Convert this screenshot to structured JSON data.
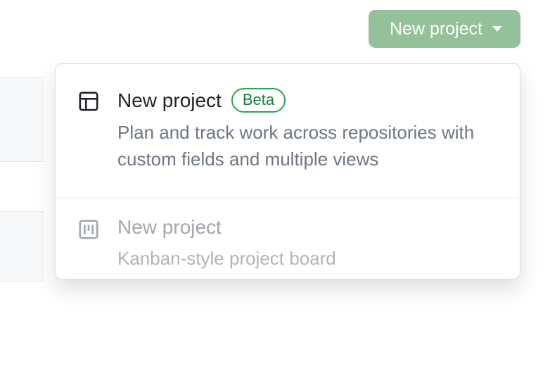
{
  "button": {
    "label": "New project"
  },
  "menu": {
    "items": [
      {
        "title": "New project",
        "badge": "Beta",
        "description": "Plan and track work across repositories with custom fields and multiple views"
      },
      {
        "title": "New project",
        "description": "Kanban-style project board"
      }
    ]
  }
}
